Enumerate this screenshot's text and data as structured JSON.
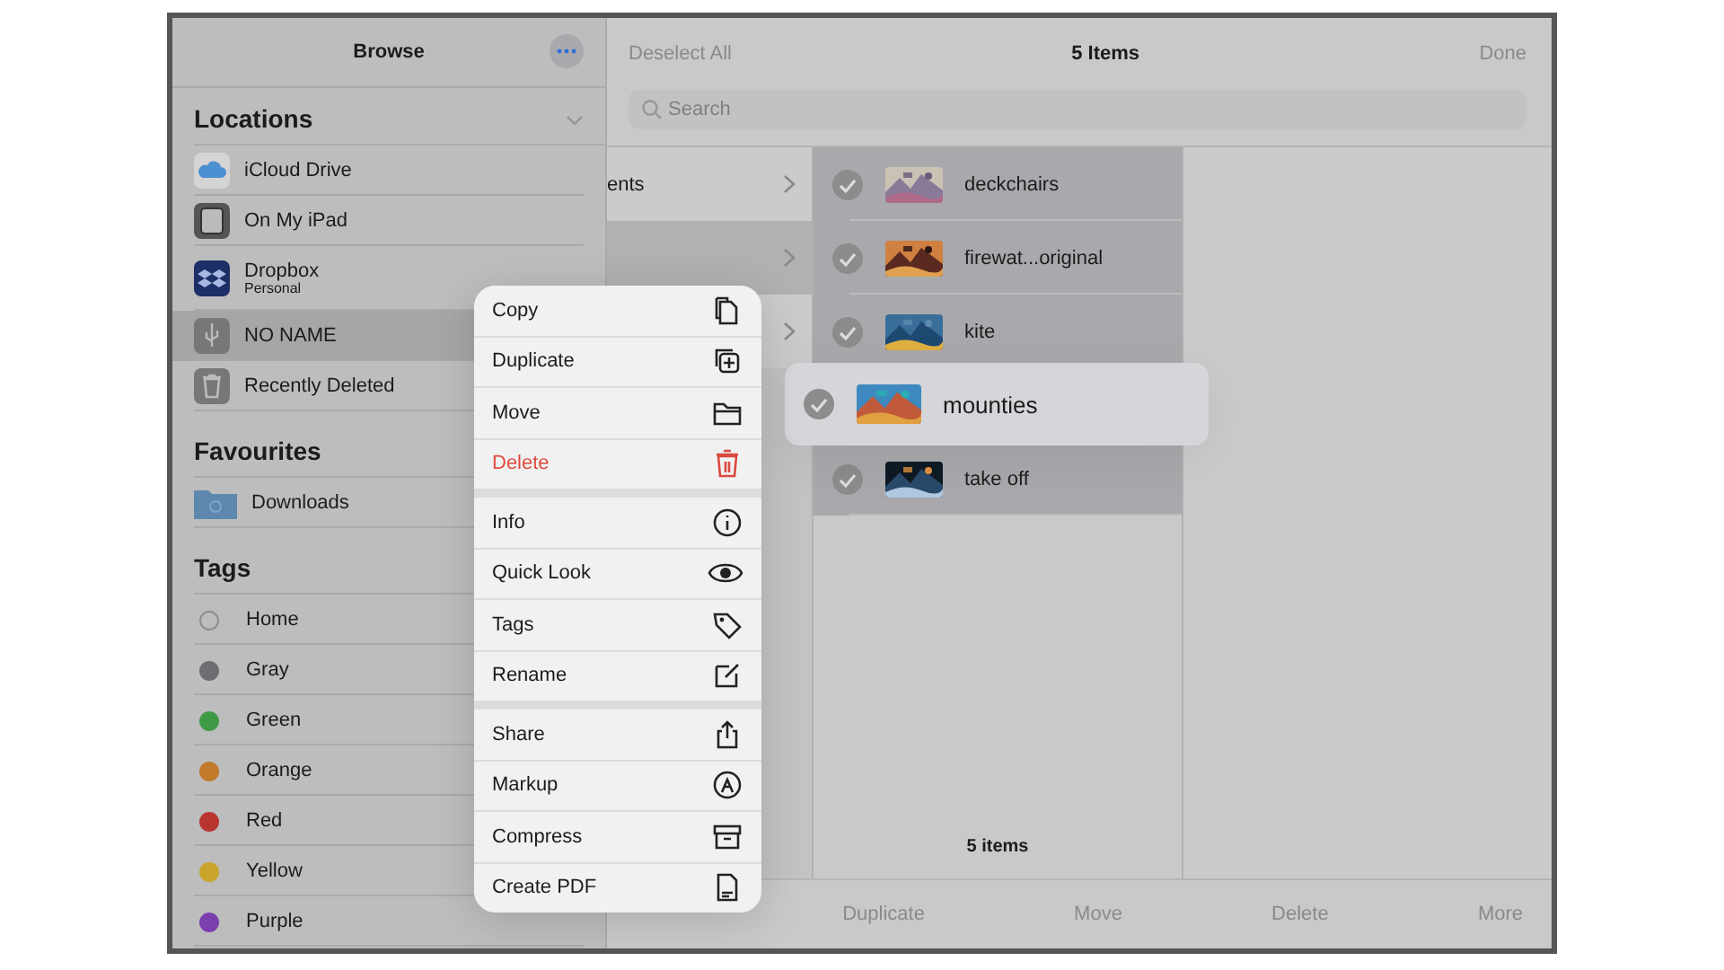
{
  "sidebar": {
    "title": "Browse",
    "locations": {
      "heading": "Locations",
      "items": [
        {
          "label": "iCloud Drive",
          "selected": false
        },
        {
          "label": "On My iPad",
          "selected": false
        },
        {
          "label": "Dropbox",
          "subtitle": "Personal",
          "selected": false
        },
        {
          "label": "NO NAME",
          "selected": true
        },
        {
          "label": "Recently Deleted",
          "selected": false
        }
      ]
    },
    "favourites": {
      "heading": "Favourites",
      "items": [
        {
          "label": "Downloads",
          "selected": false
        }
      ]
    },
    "tags": {
      "heading": "Tags",
      "items": [
        {
          "label": "Home",
          "color": "#8e8e8e",
          "hollow": true
        },
        {
          "label": "Gray",
          "color": "#6e6e72",
          "hollow": false
        },
        {
          "label": "Green",
          "color": "#3f9a45",
          "hollow": false
        },
        {
          "label": "Orange",
          "color": "#c07a2a",
          "hollow": false
        },
        {
          "label": "Red",
          "color": "#b83530",
          "hollow": false
        },
        {
          "label": "Yellow",
          "color": "#c9a52c",
          "hollow": false
        },
        {
          "label": "Purple",
          "color": "#7b3fb0",
          "hollow": false
        }
      ]
    }
  },
  "toolbar": {
    "left": "Deselect All",
    "title": "5 Items",
    "right": "Done"
  },
  "search": {
    "placeholder": "Search"
  },
  "browser_column": [
    {
      "label": "ents",
      "selected": false
    },
    {
      "selected": true
    },
    {
      "selected": false
    }
  ],
  "files": [
    {
      "name": "deckchairs",
      "selected": true,
      "lifted": false
    },
    {
      "name": "firewat...original",
      "selected": true,
      "lifted": false
    },
    {
      "name": "kite",
      "selected": true,
      "lifted": false
    },
    {
      "name": "mounties",
      "selected": true,
      "lifted": true
    },
    {
      "name": "take off",
      "selected": true,
      "lifted": false
    }
  ],
  "file_count": "5 items",
  "bottom_bar": [
    "Duplicate",
    "Move",
    "Delete",
    "More"
  ],
  "context_menu": {
    "groups": [
      [
        {
          "label": "Copy",
          "destructive": false
        },
        {
          "label": "Duplicate",
          "destructive": false
        },
        {
          "label": "Move",
          "destructive": false
        },
        {
          "label": "Delete",
          "destructive": true
        }
      ],
      [
        {
          "label": "Info",
          "destructive": false
        },
        {
          "label": "Quick Look",
          "destructive": false
        },
        {
          "label": "Tags",
          "destructive": false
        },
        {
          "label": "Rename",
          "destructive": false
        }
      ],
      [
        {
          "label": "Share",
          "destructive": false
        },
        {
          "label": "Markup",
          "destructive": false
        },
        {
          "label": "Compress",
          "destructive": false
        },
        {
          "label": "Create PDF",
          "destructive": false
        }
      ]
    ]
  }
}
